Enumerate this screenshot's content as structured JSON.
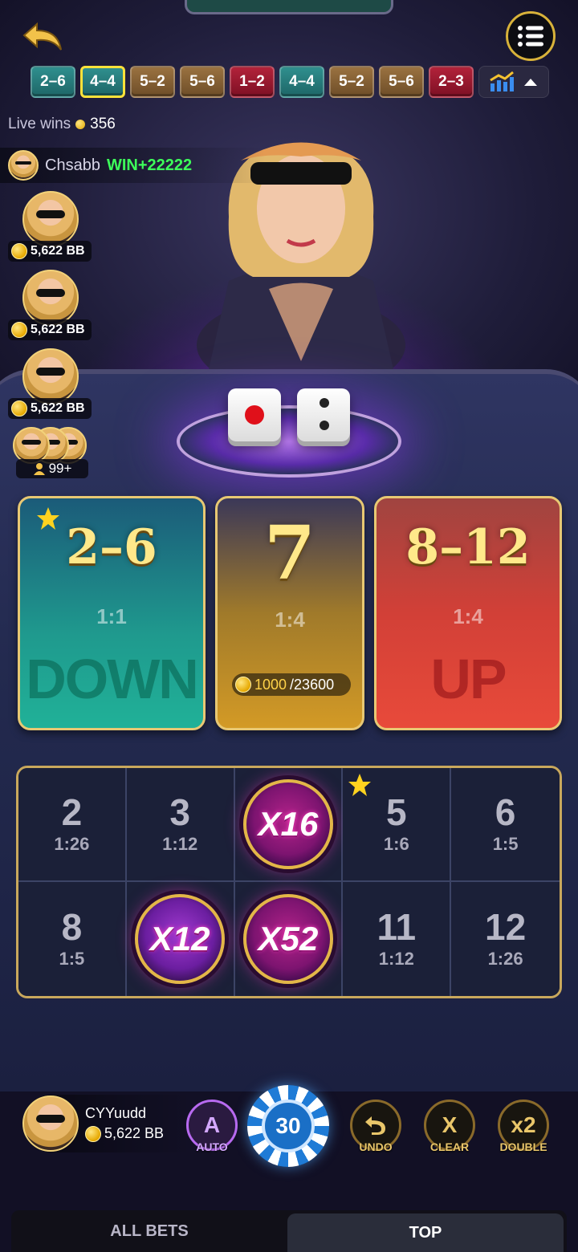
{
  "colors": {
    "gold": "#e8c873",
    "teal": "#1f9a8e",
    "red": "#d24037",
    "win_green": "#3dff5a"
  },
  "header": {
    "back_icon": "back-arrow-icon",
    "menu_icon": "menu-list-icon",
    "history": [
      {
        "label": "2–6",
        "color": "teal"
      },
      {
        "label": "4–4",
        "color": "teal",
        "selected": true
      },
      {
        "label": "5–2",
        "color": "brown"
      },
      {
        "label": "5–6",
        "color": "brown"
      },
      {
        "label": "1–2",
        "color": "red"
      },
      {
        "label": "4–4",
        "color": "teal"
      },
      {
        "label": "5–2",
        "color": "brown"
      },
      {
        "label": "5–6",
        "color": "brown"
      },
      {
        "label": "2–3",
        "color": "red"
      }
    ]
  },
  "live_wins": {
    "label": "Live wins",
    "count": "356"
  },
  "recent_win": {
    "name": "Chsabb",
    "amount": "WIN+22222"
  },
  "seats": [
    {
      "balance": "5,622 BB"
    },
    {
      "balance": "5,622 BB"
    },
    {
      "balance": "5,622 BB"
    }
  ],
  "crowd": {
    "count": "99+"
  },
  "dice": [
    1,
    2
  ],
  "bets": {
    "down": {
      "range": "2–6",
      "odds": "1:1",
      "label": "DOWN"
    },
    "seven": {
      "range": "7",
      "odds": "1:4",
      "my_bet": "1000",
      "total": "/23600"
    },
    "up": {
      "range": "8–12",
      "odds": "1:4",
      "label": "UP"
    }
  },
  "numbers": [
    {
      "n": "2",
      "o": "1:26"
    },
    {
      "n": "3",
      "o": "1:12"
    },
    {
      "mult": "X16"
    },
    {
      "n": "5",
      "o": "1:6"
    },
    {
      "n": "6",
      "o": "1:5"
    },
    {
      "n": "8",
      "o": "1:5"
    },
    {
      "mult": "X12"
    },
    {
      "mult": "X52"
    },
    {
      "n": "11",
      "o": "1:12"
    },
    {
      "n": "12",
      "o": "1:26"
    }
  ],
  "player": {
    "name": "CYYuudd",
    "balance": "5,622 BB"
  },
  "controls": {
    "auto": {
      "icon": "A",
      "label": "AUTO"
    },
    "chip": "30",
    "undo": {
      "label": "UNDO"
    },
    "clear": {
      "icon": "X",
      "label": "CLEAR"
    },
    "double": {
      "icon": "x2",
      "label": "DOUBLE"
    }
  },
  "tabs": {
    "all_bets": "ALL BETS",
    "top": "TOP"
  }
}
